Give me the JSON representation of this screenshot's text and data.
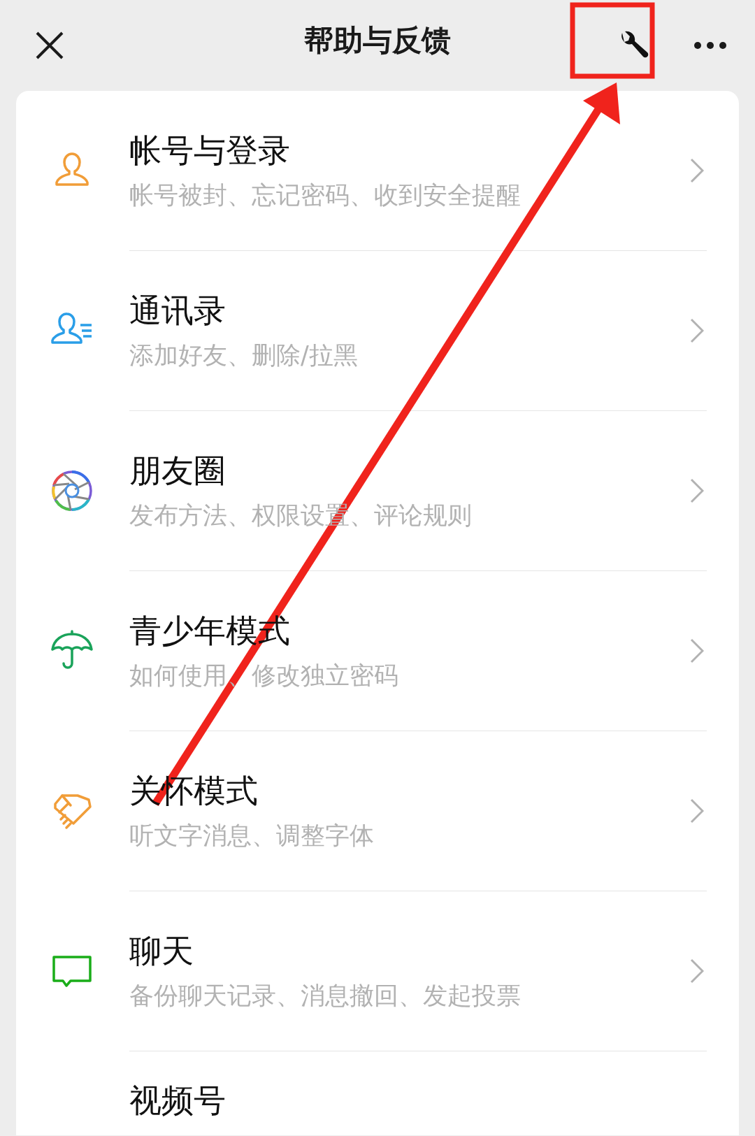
{
  "header": {
    "title": "帮助与反馈"
  },
  "items": [
    {
      "title": "帐号与登录",
      "subtitle": "帐号被封、忘记密码、收到安全提醒"
    },
    {
      "title": "通讯录",
      "subtitle": "添加好友、删除/拉黑"
    },
    {
      "title": "朋友圈",
      "subtitle": "发布方法、权限设置、评论规则"
    },
    {
      "title": "青少年模式",
      "subtitle": "如何使用、修改独立密码"
    },
    {
      "title": "关怀模式",
      "subtitle": "听文字消息、调整字体"
    },
    {
      "title": "聊天",
      "subtitle": "备份聊天记录、消息撤回、发起投票"
    },
    {
      "title": "视频号"
    }
  ]
}
